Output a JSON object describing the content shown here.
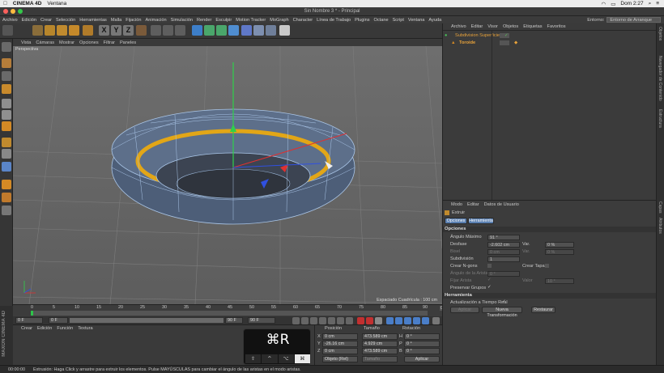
{
  "macos": {
    "app": "CINEMA 4D",
    "menu": [
      "Ventana"
    ],
    "clock": "Dom 2:27"
  },
  "window": {
    "title": "Sin Nombre 3 * - Principal"
  },
  "menubar": [
    "Archivo",
    "Edición",
    "Crear",
    "Selección",
    "Herramientas",
    "Malla",
    "Fijación",
    "Animación",
    "Simulación",
    "Render",
    "Esculpir",
    "Motion Tracker",
    "MoGraph",
    "Character",
    "Línea de Trabajo",
    "Plugins",
    "Octane",
    "Script",
    "Ventana",
    "Ayuda"
  ],
  "layout": {
    "label": "Entorno:",
    "value": "Entorno de Arranque"
  },
  "toolbar": {
    "axis_x": "X",
    "axis_y": "Y",
    "axis_z": "Z"
  },
  "viewport": {
    "menu": [
      "Vista",
      "Cámaras",
      "Mostrar",
      "Opciones",
      "Filtrar",
      "Paneles"
    ],
    "camera": "Perspectiva",
    "grid_spacing": "Espaciado Cuadrícula : 100 cm"
  },
  "timeline": {
    "ticks": [
      "0",
      "5",
      "10",
      "15",
      "20",
      "25",
      "30",
      "35",
      "40",
      "45",
      "50",
      "55",
      "60",
      "65",
      "70",
      "75",
      "80",
      "85",
      "90"
    ],
    "frame_field": "0 F",
    "start": "0 F",
    "current": "0 F",
    "end": "90 F",
    "max": "90 F"
  },
  "material_manager": {
    "menu": [
      "Crear",
      "Edición",
      "Función",
      "Textura"
    ]
  },
  "maxon_logo": "MAXON CINEMA 4D",
  "coords": {
    "headers": [
      "Posición",
      "Tamaño",
      "Rotación"
    ],
    "rows": [
      {
        "axis": "X",
        "pos": "0 cm",
        "size": "473.589 cm",
        "rot_label": "H",
        "rot": "0 °"
      },
      {
        "axis": "Y",
        "pos": "-26.16 cm",
        "size": "4.929 cm",
        "rot_label": "P",
        "rot": "0 °"
      },
      {
        "axis": "Z",
        "pos": "0 cm",
        "size": "473.589 cm",
        "rot_label": "B",
        "rot": "0 °"
      }
    ],
    "mode": "Objeto (Rel)",
    "size_mode": "Tamaño",
    "apply": "Aplicar"
  },
  "keyhud": {
    "combo": "⌘R",
    "keys": [
      "⇧",
      "^",
      "⌥",
      "⌘"
    ]
  },
  "status": {
    "time": "00:00:00",
    "text": "Extrusión: Haga Click y arrastre para extruir los elementos. Pulse MAYÚSCULAS para cambiar el ángulo de las aristas en el modo aristas."
  },
  "object_manager": {
    "menu": [
      "Archivo",
      "Editar",
      "Visor",
      "Objetos",
      "Etiquetas",
      "Favoritos"
    ],
    "objects": [
      {
        "name": "Subdivision Superficie"
      },
      {
        "name": "Toroide"
      }
    ]
  },
  "attributes": {
    "menu": [
      "Modo",
      "Editar",
      "Datos de Usuario"
    ],
    "tool": "Extruir",
    "tabs": [
      "Opciones",
      "Herramienta"
    ],
    "opciones_title": "Opciones",
    "angle_max_label": "Ángulo Máximo",
    "angle_max": "91 °",
    "offset_label": "Desfase",
    "offset": "-2.602 cm",
    "var_label": "Var.",
    "var_val": "0 %",
    "bevel_label": "Bisel",
    "bevel": "0 cm",
    "var2_label": "Var.",
    "var2_val": "0 %",
    "subdiv_label": "Subdivisión",
    "subdiv": "1",
    "ngons_label": "Crear N-gons",
    "caps_label": "Crear Tapas",
    "edge_angle_label": "Ángulo de la Arista",
    "edge_angle": "0 °",
    "edge_limit_label": "Fijar Arista",
    "value_label": "Valor",
    "value_val": "10 °",
    "preserve_label": "Preservar Grupos",
    "tool_title": "Herramienta",
    "realtime_label": "Actualización a Tiempo Real",
    "apply": "Aplicar",
    "new_transform": "Nueva Transformación",
    "reset": "Restaurar"
  },
  "side_tabs": [
    "Objetos",
    "Navegador de Contenido",
    "Estructura",
    "Capas",
    "Atributos"
  ]
}
